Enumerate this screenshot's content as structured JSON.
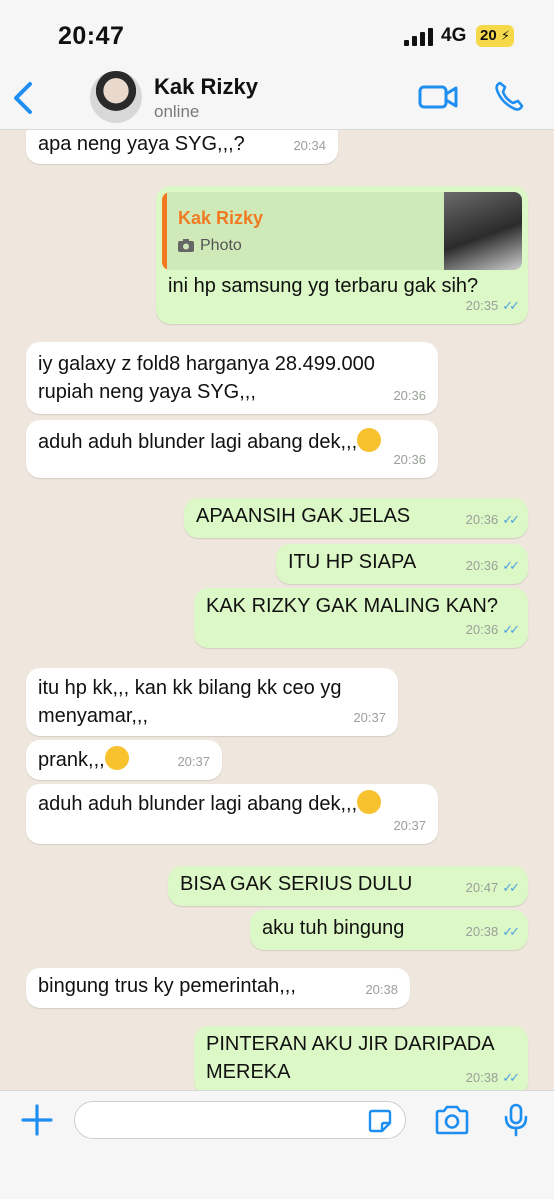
{
  "status_bar": {
    "time": "20:47",
    "network": "4G",
    "battery": "20"
  },
  "header": {
    "contact_name": "Kak Rizky",
    "contact_status": "online"
  },
  "quote": {
    "name": "Kak Rizky",
    "type": "Photo"
  },
  "messages": [
    {
      "text": "apa neng yaya SYG,,,?",
      "time": "20:34",
      "dir": "in"
    },
    {
      "text": "ini hp samsung yg terbaru gak sih?",
      "time": "20:35",
      "dir": "out"
    },
    {
      "text": "iy galaxy z fold8 harganya 28.499.000 rupiah neng yaya SYG,,,",
      "time": "20:36",
      "dir": "in"
    },
    {
      "text": "aduh aduh blunder lagi abang dek,,,",
      "time": "20:36",
      "dir": "in"
    },
    {
      "text": "APAANSIH GAK JELAS",
      "time": "20:36",
      "dir": "out"
    },
    {
      "text": "ITU HP SIAPA",
      "time": "20:36",
      "dir": "out"
    },
    {
      "text": "KAK RIZKY GAK MALING KAN?",
      "time": "20:36",
      "dir": "out"
    },
    {
      "text": "itu hp kk,,, kan kk bilang kk ceo yg menyamar,,,",
      "time": "20:37",
      "dir": "in"
    },
    {
      "text": "prank,,,",
      "time": "20:37",
      "dir": "in"
    },
    {
      "text": "aduh aduh blunder lagi abang dek,,,",
      "time": "20:37",
      "dir": "in"
    },
    {
      "text": "BISA GAK SERIUS DULU",
      "time": "20:47",
      "dir": "out"
    },
    {
      "text": "aku tuh bingung",
      "time": "20:38",
      "dir": "out"
    },
    {
      "text": "bingung trus ky pemerintah,,,",
      "time": "20:38",
      "dir": "in"
    },
    {
      "text": "PINTERAN AKU JIR DARIPADA MEREKA",
      "time": "20:38",
      "dir": "out"
    }
  ],
  "composer": {
    "value": "",
    "placeholder": ""
  },
  "icons": {
    "back": "chevron-left-icon",
    "video": "video-camera-icon",
    "call": "phone-icon",
    "plus": "plus-icon",
    "sticker": "sticker-icon",
    "camera": "camera-icon",
    "mic": "microphone-icon",
    "emoji": "rolling-laughing-emoji-icon"
  },
  "colors": {
    "accent": "#1f8ef1",
    "outgoing": "#dcf8c6",
    "incoming": "#ffffff",
    "quote_name": "#f07b22",
    "read_ticks": "#4fa3e0"
  }
}
